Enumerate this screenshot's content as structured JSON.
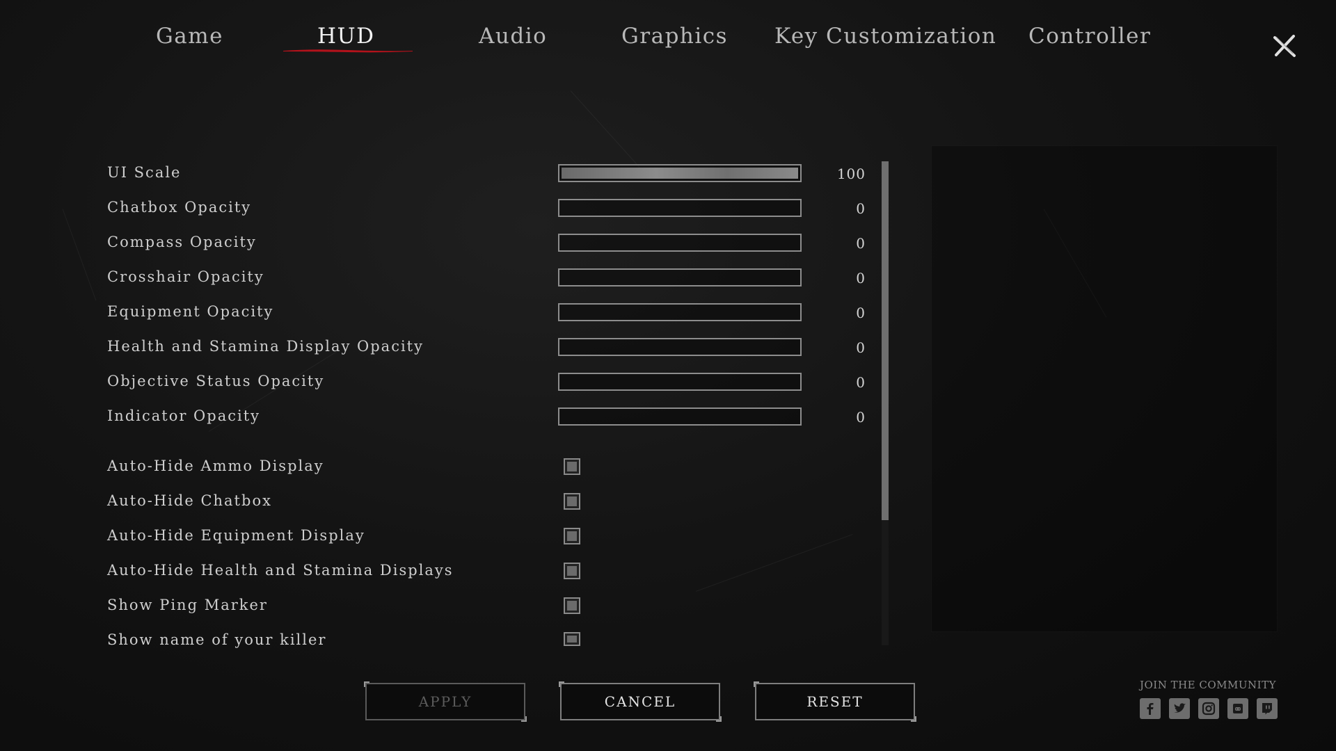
{
  "tabs": [
    {
      "label": "Game"
    },
    {
      "label": "HUD"
    },
    {
      "label": "Audio"
    },
    {
      "label": "Graphics"
    },
    {
      "label": "Key Customization"
    },
    {
      "label": "Controller"
    }
  ],
  "active_tab": "HUD",
  "accent_color": "#b3121b",
  "sliders": [
    {
      "label": "UI Scale",
      "value": "100",
      "level": 1.0
    },
    {
      "label": "Chatbox Opacity",
      "value": "0",
      "level": 0
    },
    {
      "label": "Compass Opacity",
      "value": "0",
      "level": 0
    },
    {
      "label": "Crosshair Opacity",
      "value": "0",
      "level": 0
    },
    {
      "label": "Equipment Opacity",
      "value": "0",
      "level": 0
    },
    {
      "label": "Health and Stamina Display Opacity",
      "value": "0",
      "level": 0
    },
    {
      "label": "Objective Status Opacity",
      "value": "0",
      "level": 0
    },
    {
      "label": "Indicator Opacity",
      "value": "0",
      "level": 0
    }
  ],
  "toggles": [
    {
      "label": "Auto-Hide Ammo Display"
    },
    {
      "label": "Auto-Hide Chatbox"
    },
    {
      "label": "Auto-Hide Equipment Display"
    },
    {
      "label": "Auto-Hide Health and Stamina Displays"
    },
    {
      "label": "Show Ping Marker"
    },
    {
      "label": "Show name of your killer"
    }
  ],
  "buttons": {
    "apply": "APPLY",
    "cancel": "CANCEL",
    "reset": "RESET"
  },
  "community": {
    "label": "JOIN THE COMMUNITY",
    "icons": [
      "facebook-icon",
      "twitter-icon",
      "instagram-icon",
      "discord-icon",
      "twitch-icon"
    ]
  }
}
